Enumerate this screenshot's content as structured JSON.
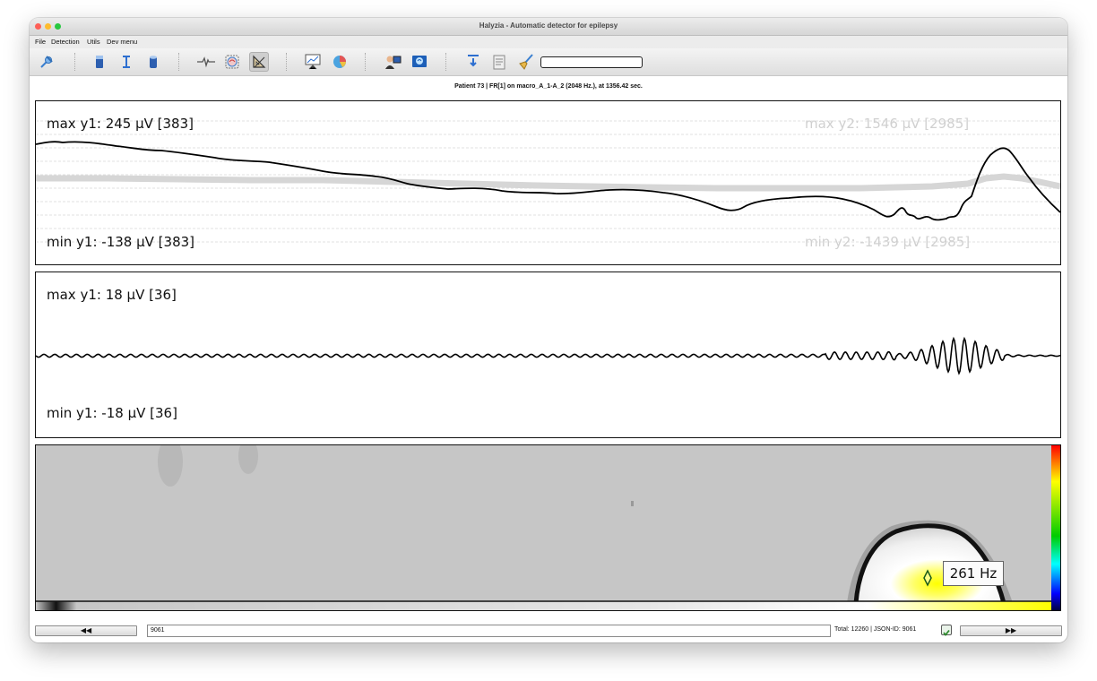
{
  "window": {
    "title": "Halyzia - Automatic detector for epilepsy",
    "traffic_lights": {
      "close": "#fe5f57",
      "minimize": "#febc2e",
      "zoom": "#28c840"
    }
  },
  "menu": [
    "File",
    "Detection",
    "Utils",
    "Dev menu"
  ],
  "toolbar": {
    "icons": [
      "pin-icon",
      "blue-block-icon",
      "cursor-i-icon",
      "blue-cylinder-icon",
      "waveform-icon",
      "brain-scan-icon",
      "ruler-triangle-icon",
      "presentation-chart-icon",
      "pie-chart-icon",
      "doctor-screen-icon",
      "brain-monitor-icon",
      "info-download-icon",
      "clipboard-list-icon",
      "broom-icon"
    ],
    "active_icon": "ruler-triangle-icon",
    "progress": 0
  },
  "info_line": "Patient 73  |  FR[1] on macro_A_1-A_2 (2048 Hz.), at 1356.42 sec.",
  "raw_panel": {
    "max_y1": "max y1: 245 µV [383]",
    "min_y1": "min y1: -138 µV [383]",
    "max_y2": "max y2: 1546 µV [2985]",
    "min_y2": "min y2: -1439 µV [2985]"
  },
  "filtered_panel": {
    "max_y1": "max y1: 18 µV [36]",
    "min_y1": "min y1: -18 µV [36]"
  },
  "spectrogram": {
    "frequency_label": "261 Hz",
    "colorbar": [
      "#ff0000",
      "#ffff00",
      "#00cc00",
      "#00ffff",
      "#0000ff",
      "#000000"
    ]
  },
  "bottom": {
    "prev_label": "◀◀",
    "next_label": "▶▶",
    "index_value": "9061",
    "total_text": "Total: 12260  |  JSON-ID: 9061",
    "validated": true
  }
}
